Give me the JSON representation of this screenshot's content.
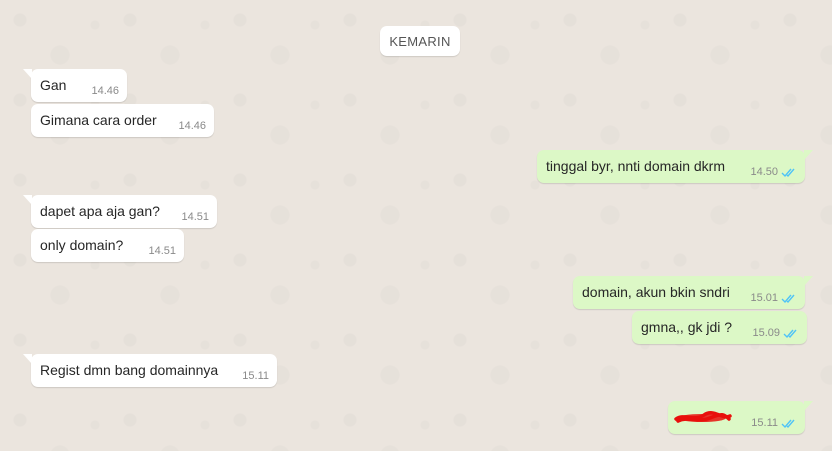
{
  "date_divider": "KEMARIN",
  "messages": [
    {
      "dir": "in",
      "text": "Gan",
      "time": "14.46"
    },
    {
      "dir": "in",
      "text": "Gimana cara order",
      "time": "14.46"
    },
    {
      "dir": "out",
      "text": "tinggal byr, nnti domain dkrm",
      "time": "14.50"
    },
    {
      "dir": "in",
      "text": "dapet apa aja gan?",
      "time": "14.51"
    },
    {
      "dir": "in",
      "text": "only domain?",
      "time": "14.51"
    },
    {
      "dir": "out",
      "text": "domain, akun bkin sndri",
      "time": "15.01"
    },
    {
      "dir": "out",
      "text": "gmna,, gk jdi ?",
      "time": "15.09"
    },
    {
      "dir": "in",
      "text": "Regist dmn bang domainnya",
      "time": "15.11"
    },
    {
      "dir": "out",
      "text": "",
      "time": "15.11",
      "redacted": true
    }
  ],
  "colors": {
    "incoming_bg": "#ffffff",
    "outgoing_bg": "#dcf8c6",
    "read_tick": "#4fc3f7",
    "redaction": "#e8100c"
  },
  "icons": {
    "read_receipt": "double-check-icon"
  }
}
